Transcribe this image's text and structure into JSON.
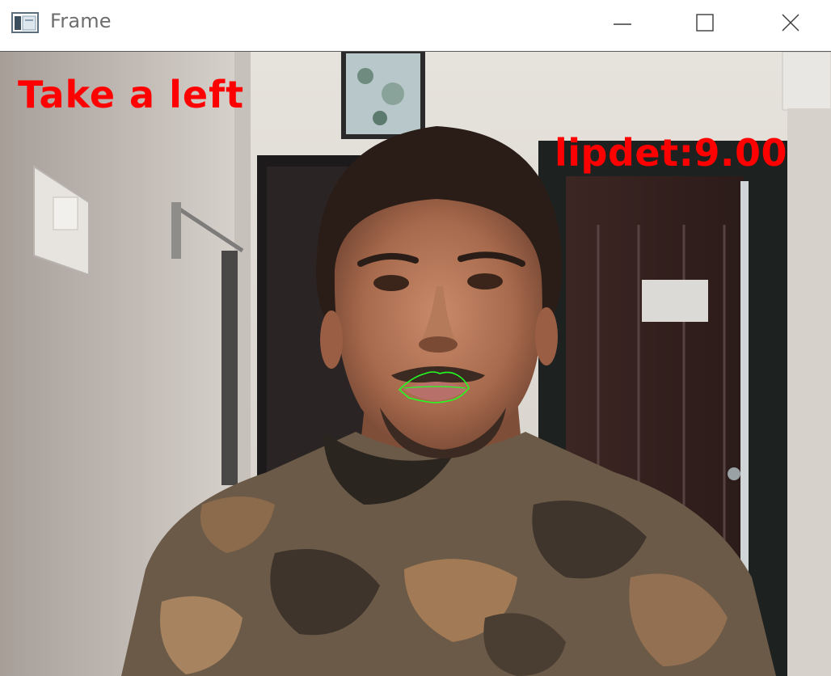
{
  "window": {
    "title": "Frame",
    "icons": {
      "app": "app-window-icon",
      "minimize": "minimize-icon",
      "maximize": "maximize-icon",
      "close": "close-icon"
    }
  },
  "overlay": {
    "direction_text": "Take a left",
    "lip_detection_text": "lipdet:9.00",
    "text_color": "#ff0000",
    "lip_outline_color": "#22ff22"
  }
}
